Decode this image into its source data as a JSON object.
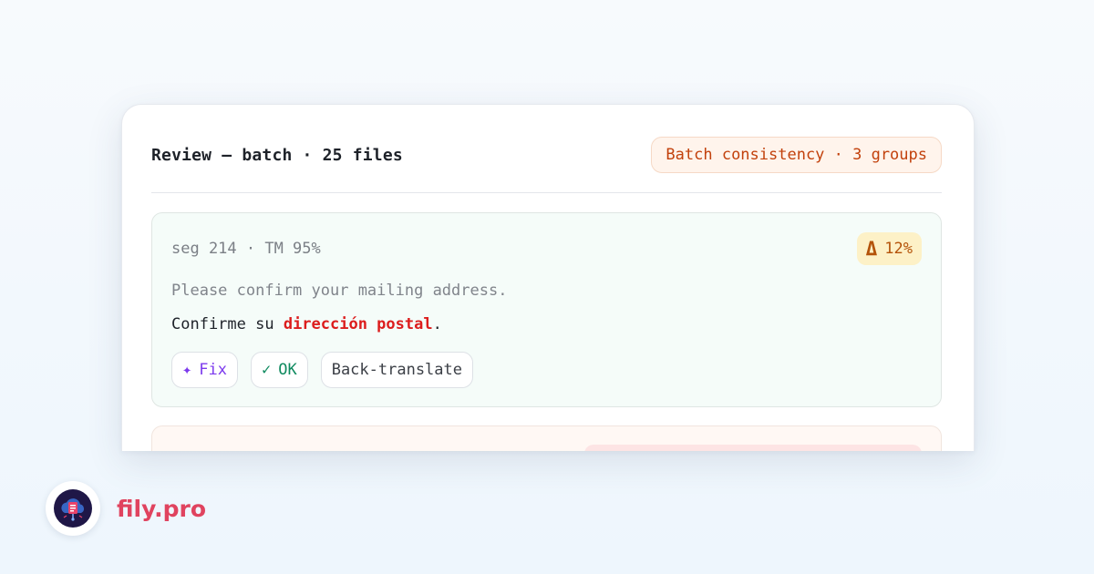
{
  "card": {
    "title": "Review — batch · 25 files",
    "batch_badge": "Batch consistency · 3 groups"
  },
  "segment": {
    "meta": "seg 214 · TM 95%",
    "delta_icon": "Δ",
    "delta_value": "12%",
    "source": "Please confirm your mailing address.",
    "target_before": "Confirme su ",
    "target_highlight": "dirección postal",
    "target_after": ".",
    "actions": {
      "fix_icon": "✦",
      "fix_label": "Fix",
      "ok_icon": "✓",
      "ok_label": "OK",
      "back_label": "Back-translate"
    }
  },
  "brand": {
    "name": "fily.pro",
    "logo_icon": "cloud-file-icon"
  },
  "colors": {
    "badge_orange": "#c2410c",
    "highlight_red": "#dc1d1d",
    "fix_purple": "#7c3aed",
    "ok_green": "#0f8a5f",
    "brand_pink": "#e0435f",
    "delta_amber": "#b45309"
  }
}
